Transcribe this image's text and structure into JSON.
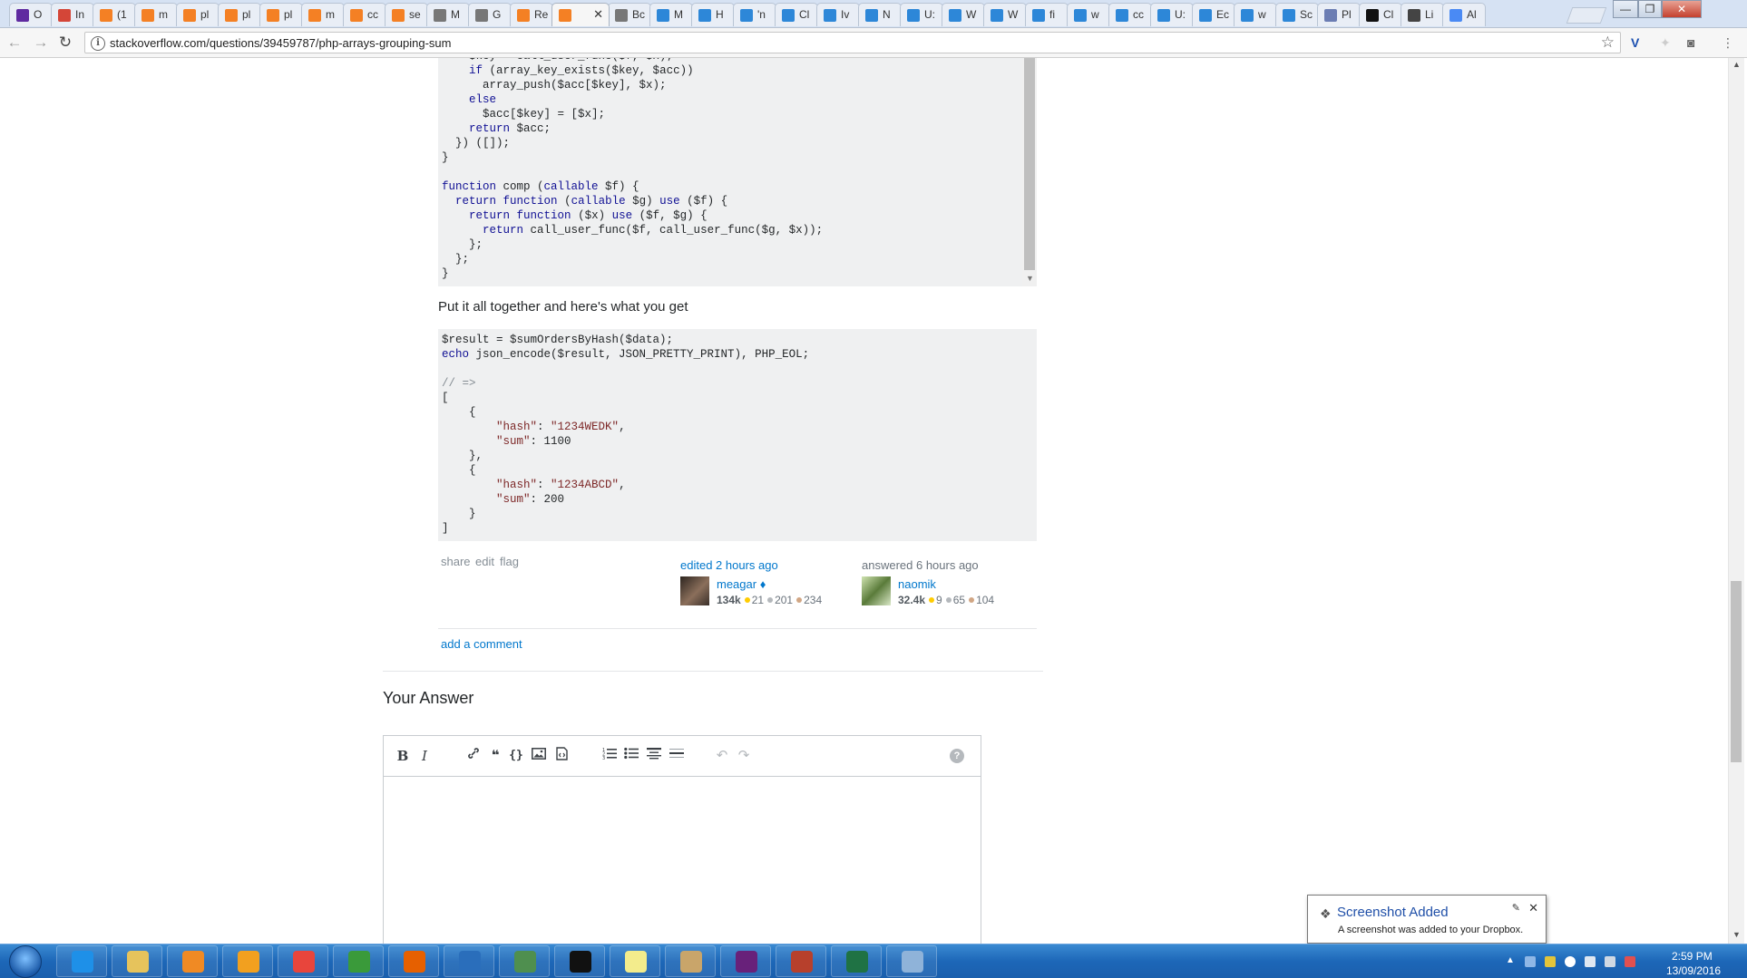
{
  "browser": {
    "tabs": [
      {
        "label": "O",
        "icon": "yahoo-icon",
        "color": "#5f2aa0"
      },
      {
        "label": "In",
        "icon": "gmail-icon",
        "color": "#d44638"
      },
      {
        "label": "(1",
        "icon": "stackoverflow-icon",
        "color": "#f48024"
      },
      {
        "label": "m",
        "icon": "stackoverflow-icon",
        "color": "#f48024"
      },
      {
        "label": "pl",
        "icon": "stackoverflow-icon",
        "color": "#f48024"
      },
      {
        "label": "pl",
        "icon": "stackoverflow-icon",
        "color": "#f48024"
      },
      {
        "label": "pl",
        "icon": "stackoverflow-icon",
        "color": "#f48024"
      },
      {
        "label": "m",
        "icon": "stackoverflow-icon",
        "color": "#f48024"
      },
      {
        "label": "cc",
        "icon": "stackoverflow-icon",
        "color": "#f48024"
      },
      {
        "label": "se",
        "icon": "stackoverflow-icon",
        "color": "#f48024"
      },
      {
        "label": "M",
        "icon": "stackexchange-icon",
        "color": "#777777"
      },
      {
        "label": "G",
        "icon": "stackexchange-icon",
        "color": "#777777"
      },
      {
        "label": "Re",
        "icon": "stackoverflow-icon",
        "color": "#f48024"
      },
      {
        "label": "",
        "icon": "stackoverflow-icon",
        "color": "#f48024"
      },
      {
        "label": "Bc",
        "icon": "stackexchange-icon",
        "color": "#777777"
      },
      {
        "label": "M",
        "icon": "generic-page-icon",
        "color": "#2d87d8"
      },
      {
        "label": "H",
        "icon": "generic-page-icon",
        "color": "#2d87d8"
      },
      {
        "label": "'n",
        "icon": "generic-page-icon",
        "color": "#2d87d8"
      },
      {
        "label": "Cl",
        "icon": "generic-page-icon",
        "color": "#2d87d8"
      },
      {
        "label": "Iv",
        "icon": "generic-page-icon",
        "color": "#2d87d8"
      },
      {
        "label": "N",
        "icon": "generic-page-icon",
        "color": "#2d87d8"
      },
      {
        "label": "U:",
        "icon": "generic-page-icon",
        "color": "#2d87d8"
      },
      {
        "label": "W",
        "icon": "generic-page-icon",
        "color": "#2d87d8"
      },
      {
        "label": "W",
        "icon": "msdn-icon",
        "color": "#2d87d8"
      },
      {
        "label": "fi",
        "icon": "msdn-icon",
        "color": "#2d87d8"
      },
      {
        "label": "w",
        "icon": "msdn-icon",
        "color": "#2d87d8"
      },
      {
        "label": "cc",
        "icon": "msdn-icon",
        "color": "#2d87d8"
      },
      {
        "label": "U:",
        "icon": "msdn-icon",
        "color": "#2d87d8"
      },
      {
        "label": "Ec",
        "icon": "msdn-icon",
        "color": "#2d87d8"
      },
      {
        "label": "w",
        "icon": "msdn-icon",
        "color": "#2d87d8"
      },
      {
        "label": "Sc",
        "icon": "msdn-icon",
        "color": "#2d87d8"
      },
      {
        "label": "Pl",
        "icon": "php-icon",
        "color": "#6b7db3"
      },
      {
        "label": "Cl",
        "icon": "medium-icon",
        "color": "#111111"
      },
      {
        "label": "Li",
        "icon": "document-icon",
        "color": "#444444"
      },
      {
        "label": "Al",
        "icon": "chrome-icon",
        "color": "#4a8af4"
      }
    ],
    "active_tab_close": "✕",
    "url": "stackoverflow.com/questions/39459787/php-arrays-grouping-sum"
  },
  "code_block_1": {
    "lines": [
      "    $key = call_user_func($f, $x);",
      "    if (array_key_exists($key, $acc))",
      "      array_push($acc[$key], $x);",
      "    else",
      "      $acc[$key] = [$x];",
      "    return $acc;",
      "  }) ([]);",
      "}",
      "",
      "function comp (callable $f) {",
      "  return function (callable $g) use ($f) {",
      "    return function ($x) use ($f, $g) {",
      "      return call_user_func($f, call_user_func($g, $x));",
      "    };",
      "  };",
      "}"
    ]
  },
  "together_text": "Put it all together and here's what you get",
  "code_block_2": {
    "lines": [
      "$result = $sumOrdersByHash($data);",
      "echo json_encode($result, JSON_PRETTY_PRINT), PHP_EOL;",
      "",
      "// =>",
      "[",
      "    {",
      "        \"hash\": \"1234WEDK\",",
      "        \"sum\": 1100",
      "    },",
      "    {",
      "        \"hash\": \"1234ABCD\",",
      "        \"sum\": 200",
      "    }",
      "]"
    ]
  },
  "post_menu": {
    "share": "share",
    "edit": "edit",
    "flag": "flag"
  },
  "edited": {
    "action": "edited 2 hours ago",
    "user": "meagar",
    "moderator_mark": "♦",
    "reputation": "134k",
    "gold": "21",
    "silver": "201",
    "bronze": "234"
  },
  "answered": {
    "action": "answered 6 hours ago",
    "user": "naomik",
    "reputation": "32.4k",
    "gold": "9",
    "silver": "65",
    "bronze": "104"
  },
  "add_comment": "add a comment",
  "your_answer_heading": "Your Answer",
  "editor_toolbar": {
    "bold": "B",
    "italic": "I",
    "quote": "❝",
    "code": "{}",
    "undo": "↶",
    "redo": "↷",
    "help": "?"
  },
  "notification": {
    "title": "Screenshot Added",
    "body": "A screenshot was added to your Dropbox."
  },
  "taskbar": {
    "apps": [
      {
        "name": "internet-explorer",
        "color": "#1e90e8"
      },
      {
        "name": "file-explorer",
        "color": "#e6c35c"
      },
      {
        "name": "media-player",
        "color": "#f08a24"
      },
      {
        "name": "outlook",
        "color": "#f2a01f"
      },
      {
        "name": "chrome",
        "color": "#e8453c"
      },
      {
        "name": "project",
        "color": "#3a9a3a"
      },
      {
        "name": "firefox",
        "color": "#e66000"
      },
      {
        "name": "thunderbird",
        "color": "#2a6ebb"
      },
      {
        "name": "task-manager",
        "color": "#4f8f4f"
      },
      {
        "name": "command-prompt",
        "color": "#111111"
      },
      {
        "name": "sticky-notes",
        "color": "#f3ec8c"
      },
      {
        "name": "tools",
        "color": "#c9a56a"
      },
      {
        "name": "visual-studio",
        "color": "#68217a"
      },
      {
        "name": "drivers",
        "color": "#b7402c"
      },
      {
        "name": "excel",
        "color": "#1f7244"
      },
      {
        "name": "paint",
        "color": "#8fb3d9"
      }
    ],
    "time": "2:59 PM",
    "date": "13/09/2016"
  }
}
